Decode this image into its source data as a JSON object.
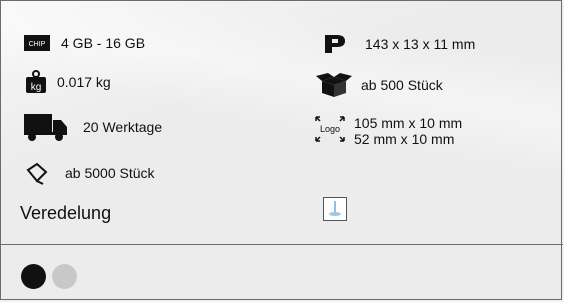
{
  "specs": {
    "memory": "4 GB - 16 GB",
    "weight": "0.017 kg",
    "delivery": "20 Werktage",
    "min_order": "ab 5000 Stück",
    "dimensions": "143 x 13 x 11 mm",
    "box_qty": "ab 500 Stück",
    "logo_size_1": "105 mm x 10 mm",
    "logo_size_2": "52 mm x 10 mm"
  },
  "icons": {
    "chip_text": "CHIP",
    "weight_text": "kg",
    "logo_text": "Logo"
  },
  "veredelung_label": "Veredelung",
  "colors": {
    "accent_black": "#111111",
    "accent_gray": "#c8c8c8"
  }
}
